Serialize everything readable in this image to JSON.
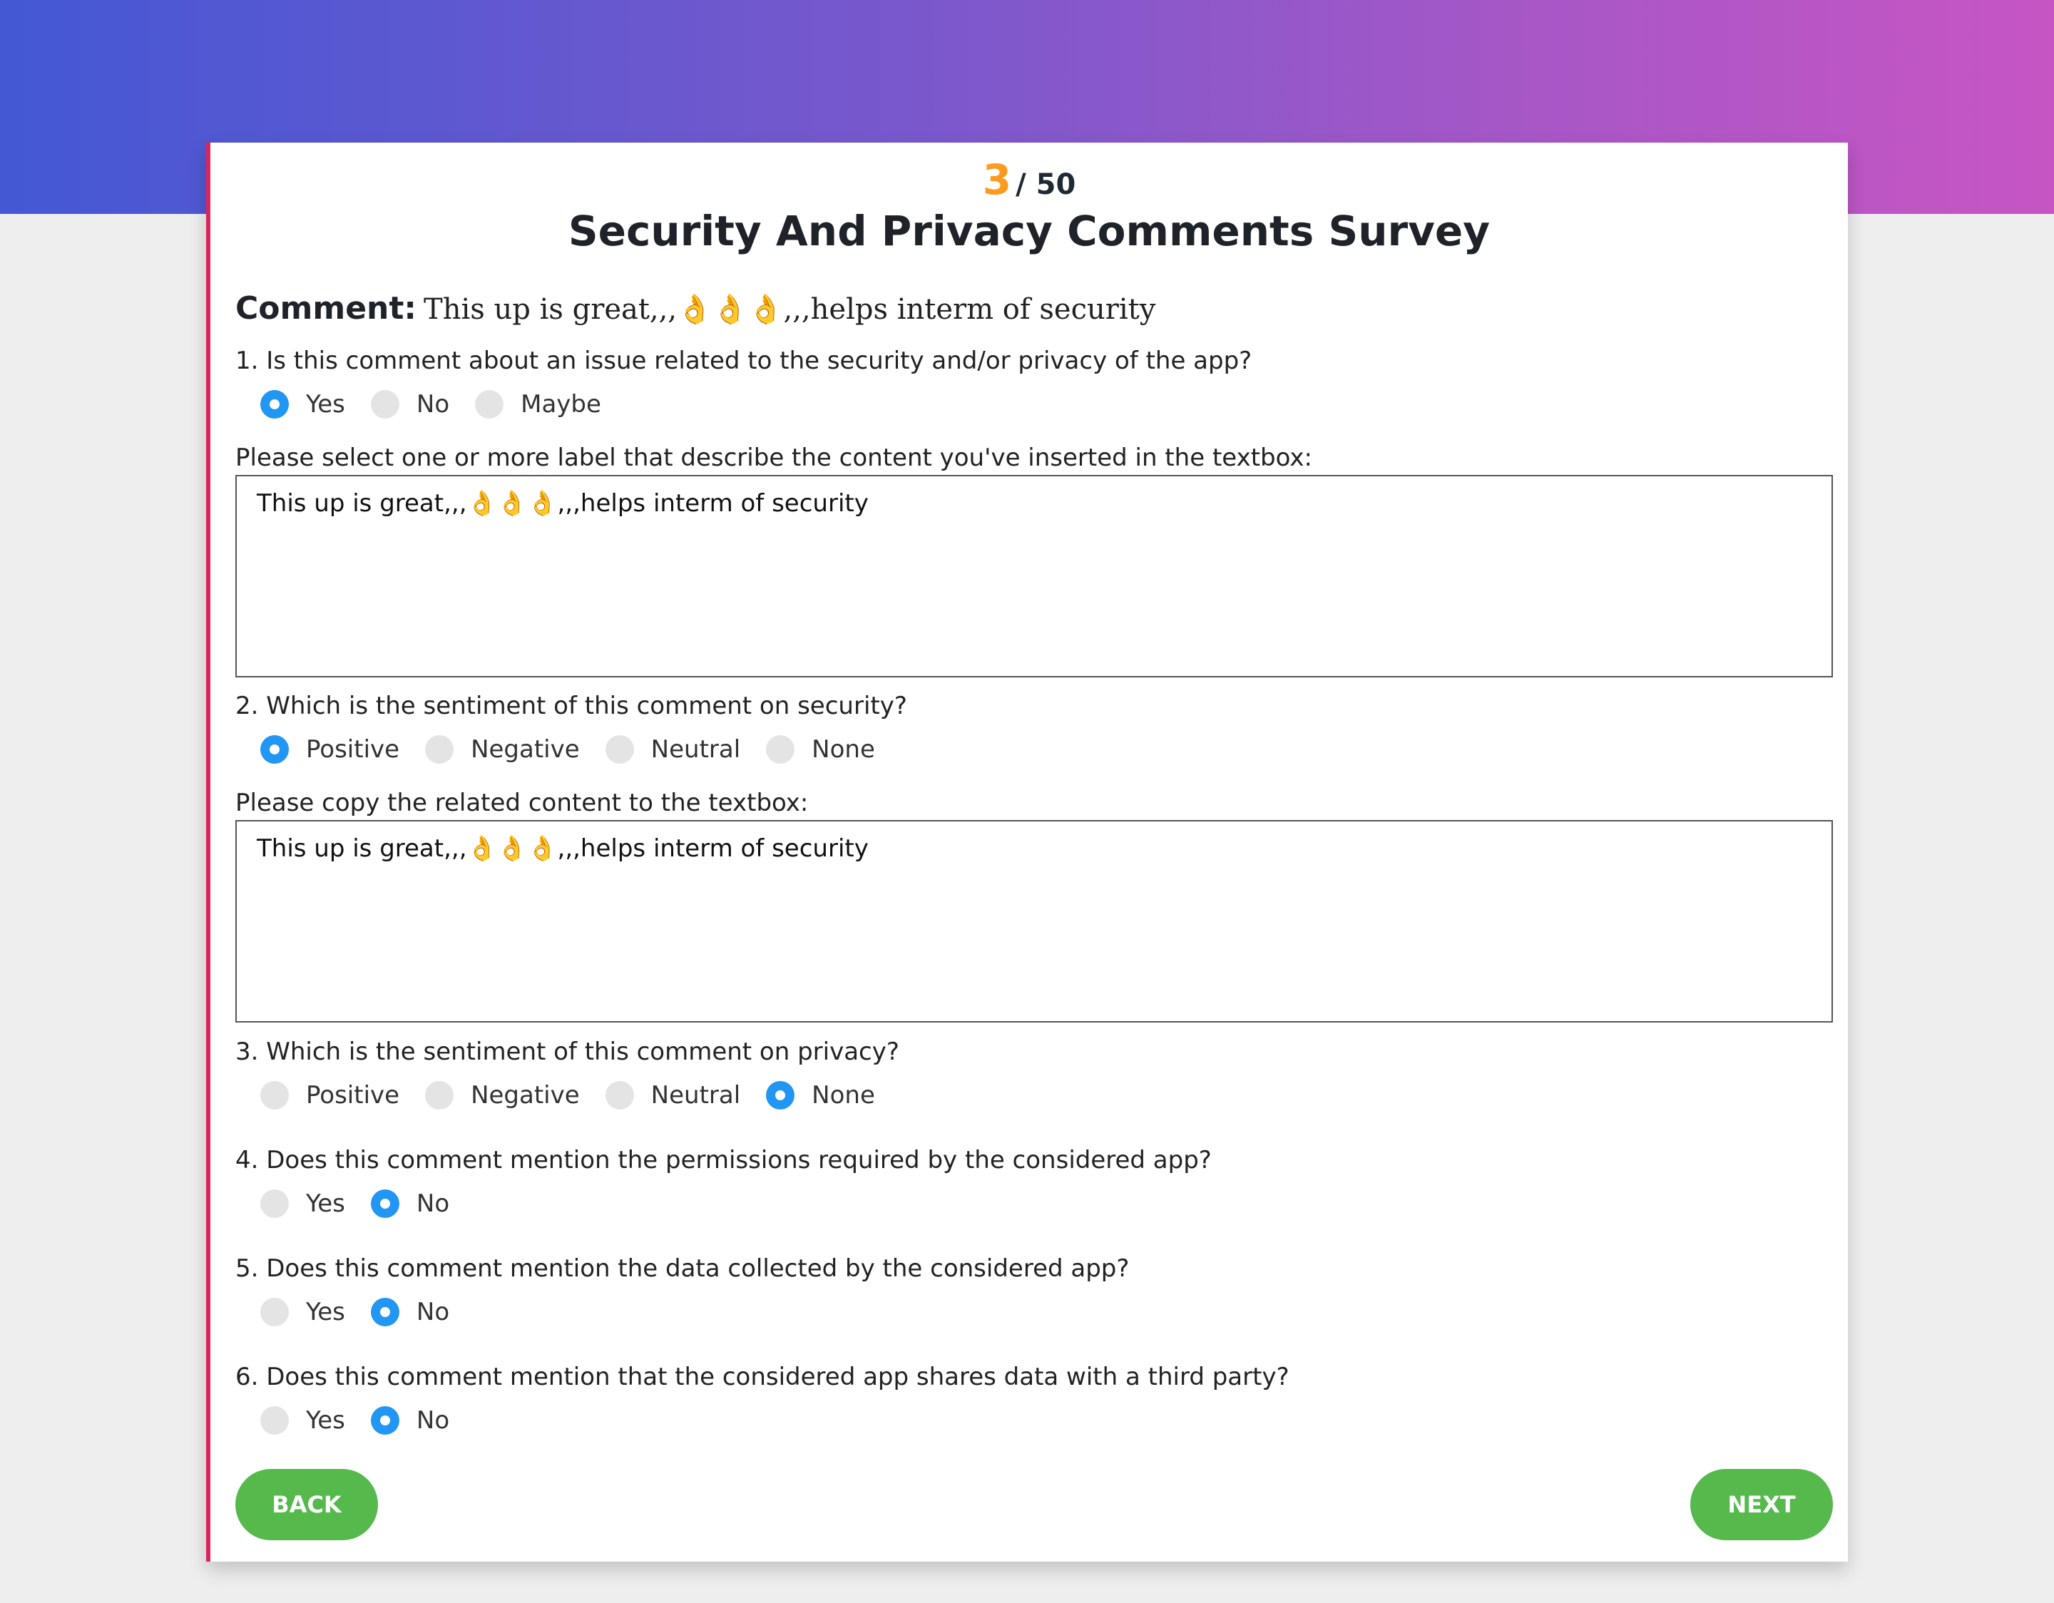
{
  "progress": {
    "current": "3",
    "total": "/ 50"
  },
  "title": "Security And Privacy Comments Survey",
  "comment": {
    "label": "Comment:",
    "text": "This up is great,,,👌👌👌,,,helps interm of security"
  },
  "q1": {
    "text": "1. Is this comment about an issue related to the security and/or privacy of the app?",
    "options": [
      "Yes",
      "No",
      "Maybe"
    ],
    "selected": "Yes"
  },
  "labels_prompt": "Please select one or more label that describe the content you've inserted in the textbox:",
  "textbox1": "This up is great,,,👌👌👌,,,helps interm of security",
  "q2": {
    "text": "2. Which is the sentiment of this comment on security?",
    "options": [
      "Positive",
      "Negative",
      "Neutral",
      "None"
    ],
    "selected": "Positive"
  },
  "copy_prompt": "Please copy the related content to the textbox:",
  "textbox2": "This up is great,,,👌👌👌,,,helps interm of security",
  "q3": {
    "text": "3. Which is the sentiment of this comment on privacy?",
    "options": [
      "Positive",
      "Negative",
      "Neutral",
      "None"
    ],
    "selected": "None"
  },
  "q4": {
    "text": "4. Does this comment mention the permissions required by the considered app?",
    "options": [
      "Yes",
      "No"
    ],
    "selected": "No"
  },
  "q5": {
    "text": "5. Does this comment mention the data collected by the considered app?",
    "options": [
      "Yes",
      "No"
    ],
    "selected": "No"
  },
  "q6": {
    "text": "6. Does this comment mention that the considered app shares data with a third party?",
    "options": [
      "Yes",
      "No"
    ],
    "selected": "No"
  },
  "buttons": {
    "back": "BACK",
    "next": "NEXT"
  },
  "colors": {
    "accent_radio": "#2196f3",
    "progress_current": "#ff9a1f",
    "button": "#55b94c",
    "card_border": "#d9265e",
    "gradient_start": "#4458d4",
    "gradient_end": "#c755c4"
  }
}
